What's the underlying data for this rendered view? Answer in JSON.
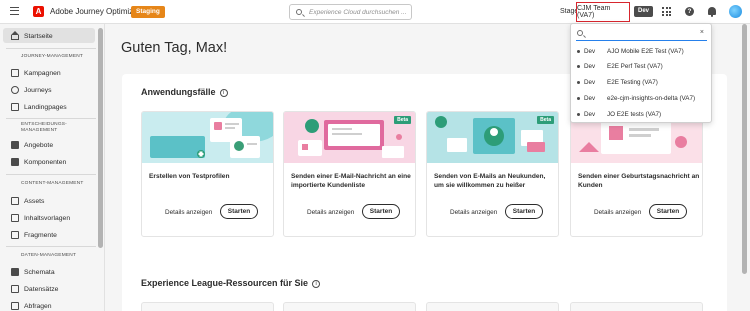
{
  "header": {
    "app_title": "Adobe Journey Optimizer",
    "env_badge": "Staging",
    "search_placeholder": "Experience Cloud durchsuchen ...",
    "stage_label": "Stage",
    "sandbox_name": "CJM Team (VA7)",
    "sandbox_env": "Dev",
    "help_glyph": "?",
    "colors": {
      "accent": "#eb1000",
      "staging": "#e68619",
      "highlight_border": "#d7262e"
    }
  },
  "sidebar": {
    "home": "Startseite",
    "sections": [
      {
        "title": "JOURNEY-MANAGEMENT",
        "items": [
          "Kampagnen",
          "Journeys",
          "Landingpages"
        ]
      },
      {
        "title": "ENTSCHEIDUNGS-MANAGEMENT",
        "items": [
          "Angebote",
          "Komponenten"
        ]
      },
      {
        "title": "CONTENT-MANAGEMENT",
        "items": [
          "Assets",
          "Inhaltsvorlagen",
          "Fragmente"
        ]
      },
      {
        "title": "DATEN-MANAGEMENT",
        "items": [
          "Schemata",
          "Datensätze",
          "Abfragen"
        ]
      }
    ]
  },
  "main": {
    "greeting": "Guten Tag, Max!",
    "use_cases": {
      "title": "Anwendungsfälle",
      "info_glyph": "i",
      "cards": [
        {
          "title": "Erstellen von Testprofilen",
          "details": "Details anzeigen",
          "start": "Starten",
          "beta": ""
        },
        {
          "title": "Senden einer E-Mail-Nachricht an eine importierte Kundenliste",
          "details": "Details anzeigen",
          "start": "Starten",
          "beta": "Beta"
        },
        {
          "title": "Senden von E-Mails an Neukunden, um sie willkommen zu heißer",
          "details": "Details anzeigen",
          "start": "Starten",
          "beta": "Beta"
        },
        {
          "title": "Senden einer Geburtstagsnachricht an Kunden",
          "details": "Details anzeigen",
          "start": "Starten",
          "beta": ""
        }
      ]
    },
    "resources": {
      "title": "Experience League-Ressourcen für Sie",
      "info_glyph": "i"
    }
  },
  "sandbox_dropdown": {
    "search_value": "",
    "clear_glyph": "×",
    "items": [
      {
        "env": "Dev",
        "name": "AJO Mobile E2E Test (VA7)"
      },
      {
        "env": "Dev",
        "name": "E2E Perf Test (VA7)"
      },
      {
        "env": "Dev",
        "name": "E2E Testing (VA7)"
      },
      {
        "env": "Dev",
        "name": "e2e-cjm-insights-on-delta (VA7)"
      },
      {
        "env": "Dev",
        "name": "JO E2E tests (VA7)"
      }
    ]
  }
}
